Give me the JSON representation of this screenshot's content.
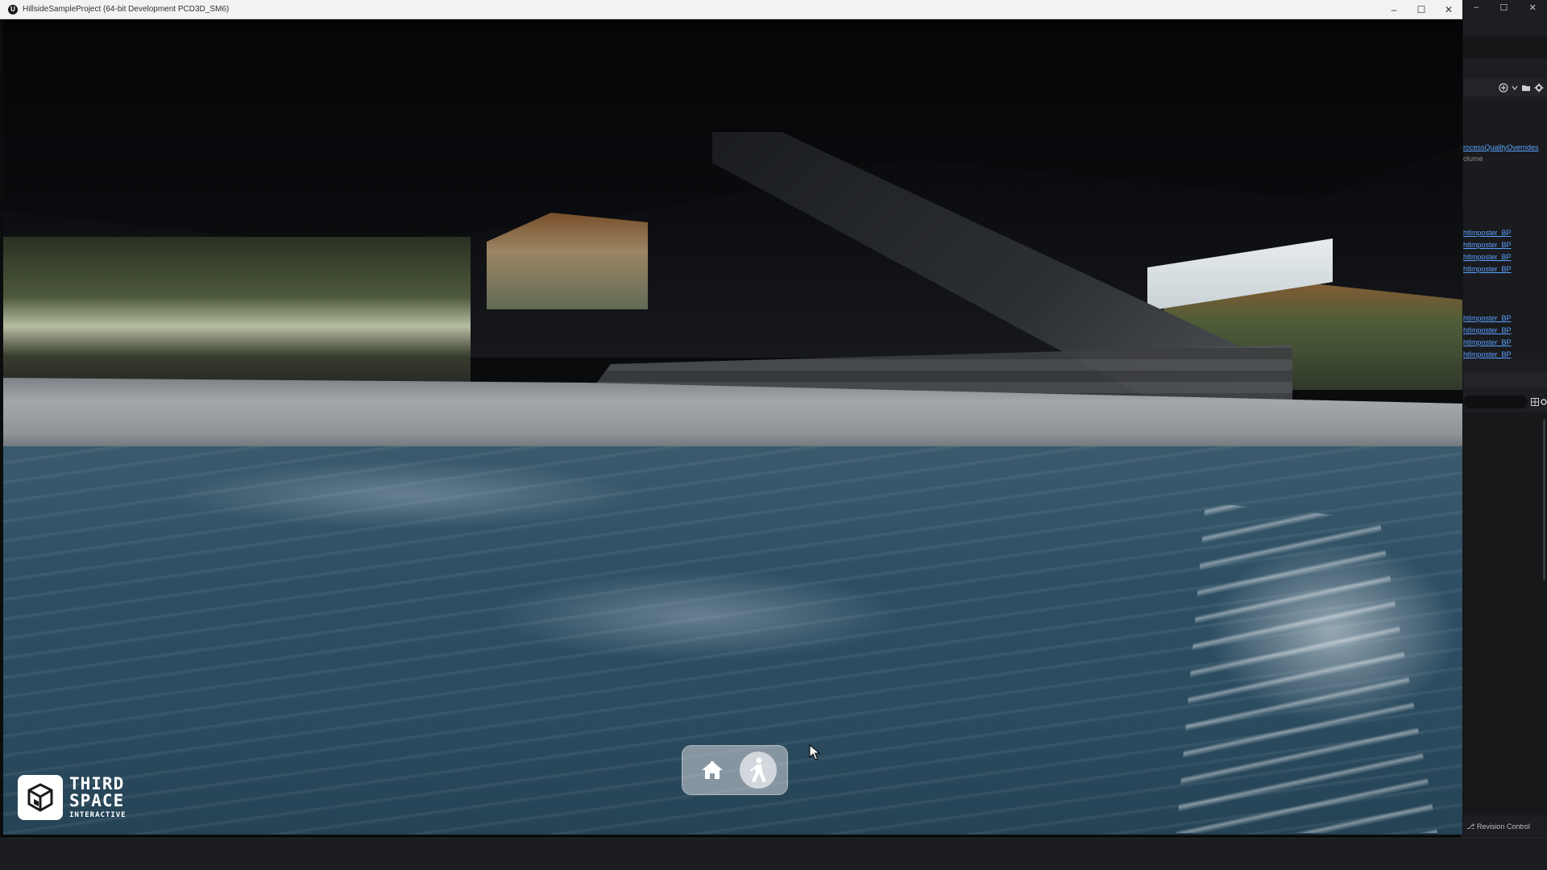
{
  "window": {
    "title": "HillsideSampleProject (64-bit Development PCD3D_SM6)",
    "app_icon": "unreal-engine-icon",
    "controls": {
      "minimize": "–",
      "maximize": "☐",
      "close": "✕"
    }
  },
  "overlay": {
    "nav": {
      "home_icon": "home-icon",
      "walk_icon": "walk-icon"
    },
    "logo": {
      "line1": "THIRD",
      "line2": "SPACE",
      "line3": "INTERACTIVE"
    }
  },
  "editor": {
    "window_controls": {
      "minimize": "–",
      "maximize": "☐",
      "close": "✕"
    },
    "rows": [
      {
        "text": "rocessQualityOverrides",
        "style": "link"
      },
      {
        "text": "olume",
        "style": "dim"
      },
      {
        "text": "htImposter_BP",
        "style": "link"
      },
      {
        "text": "htImposter_BP",
        "style": "link"
      },
      {
        "text": "htImposter_BP",
        "style": "link"
      },
      {
        "text": "htImposter_BP",
        "style": "link"
      },
      {
        "text": "htImposter_BP",
        "style": "link"
      },
      {
        "text": "htImposter_BP",
        "style": "link"
      },
      {
        "text": "htImposter_BP",
        "style": "link"
      },
      {
        "text": "htImposter_BP",
        "style": "link"
      }
    ],
    "revision_control": "Revision Control"
  },
  "colors": {
    "water": "#2e4f63",
    "pill_bg": "#d2d6da",
    "editor_link": "#5aa0ff",
    "editor_bg": "#1d1e21"
  }
}
